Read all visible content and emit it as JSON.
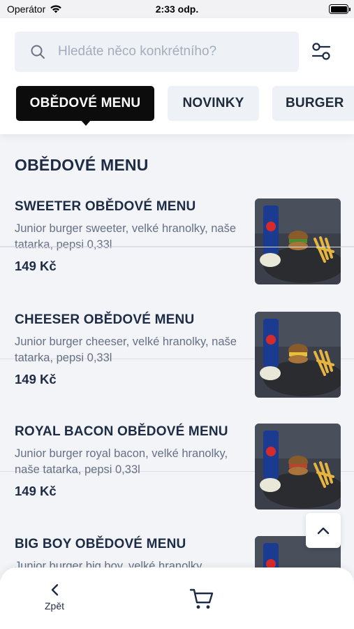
{
  "status_bar": {
    "carrier": "Operátor",
    "time": "2:33 odp."
  },
  "search": {
    "placeholder": "Hledáte něco konkrétního?"
  },
  "icons": {
    "search": "search-icon",
    "filter": "sliders-icon",
    "scroll_top": "chevron-up-icon",
    "back": "chevron-left-icon",
    "cart": "cart-icon"
  },
  "tabs": [
    {
      "label": "OBĚDOVÉ MENU",
      "active": true
    },
    {
      "label": "NOVINKY",
      "active": false
    },
    {
      "label": "BURGER",
      "active": false
    }
  ],
  "section_title": "OBĚDOVÉ MENU",
  "items": [
    {
      "name": "SWEETER OBĚDOVÉ MENU",
      "description": "Junior burger sweeter, velké hranolky, naše tatarka, pepsi 0,33l",
      "price": "149 Kč"
    },
    {
      "name": "CHEESER OBĚDOVÉ MENU",
      "description": "Junior burger cheeser, velké hranolky, naše tatarka, pepsi 0,33l",
      "price": "149 Kč"
    },
    {
      "name": "ROYAL BACON OBĚDOVÉ MENU",
      "description": "Junior burger royal bacon, velké hranolky, naše tatarka, pepsi 0,33l",
      "price": "149 Kč"
    },
    {
      "name": "BIG BOY OBĚDOVÉ MENU",
      "description": "Junior burger big boy, velké hranolky",
      "price": ""
    }
  ],
  "bottom_bar": {
    "back_label": "Zpět"
  },
  "colors": {
    "accent": "#0c0c0c",
    "text_dark": "#1d2b45",
    "text_muted": "#667085",
    "background": "#f2f4f7"
  }
}
